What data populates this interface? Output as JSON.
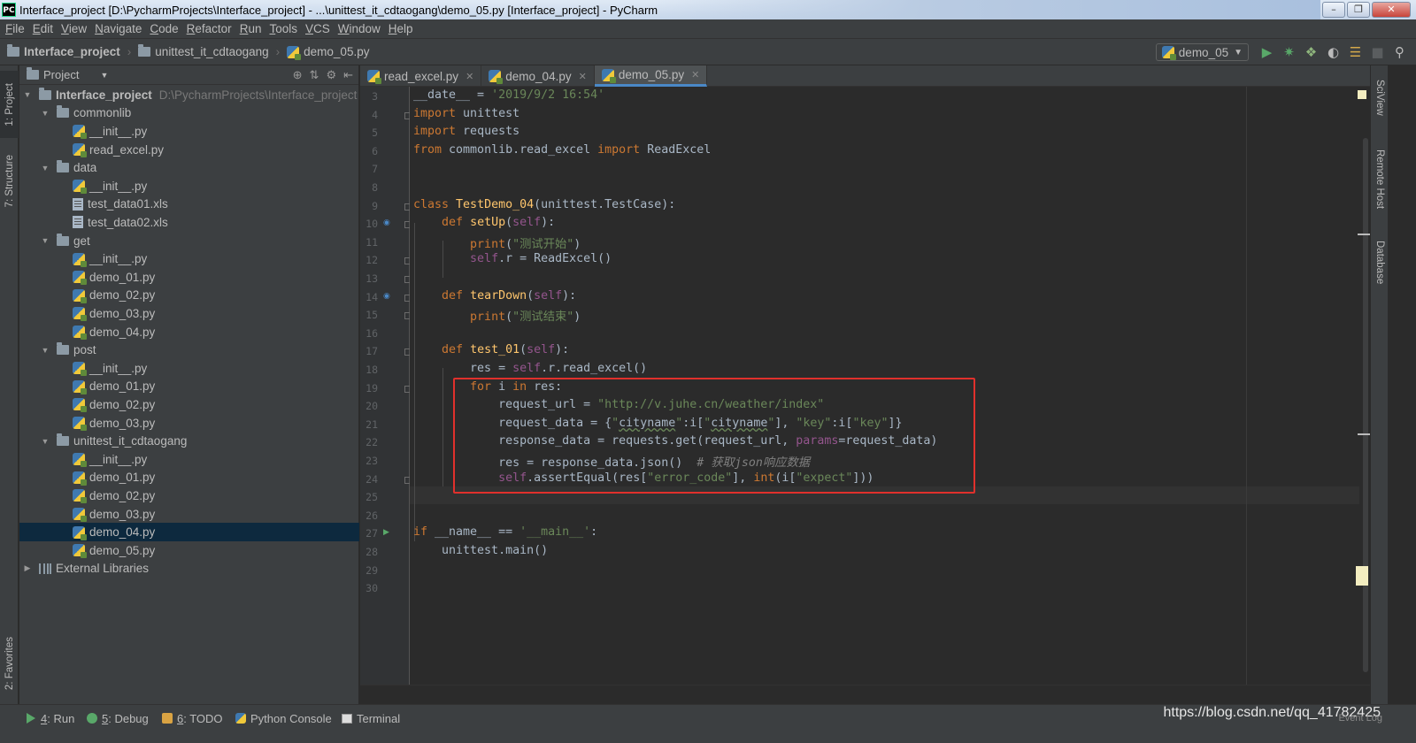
{
  "window": {
    "title": "Interface_project [D:\\PycharmProjects\\Interface_project] - ...\\unittest_it_cdtaogang\\demo_05.py [Interface_project] - PyCharm",
    "app_icon": "PC"
  },
  "menu": [
    {
      "u": "F",
      "rest": "ile"
    },
    {
      "u": "E",
      "rest": "dit"
    },
    {
      "u": "V",
      "rest": "iew"
    },
    {
      "u": "N",
      "rest": "avigate"
    },
    {
      "u": "C",
      "rest": "ode"
    },
    {
      "u": "R",
      "rest": "efactor"
    },
    {
      "u": "R",
      "rest": "un"
    },
    {
      "u": "T",
      "rest": "ools"
    },
    {
      "u": "V",
      "rest": "CS"
    },
    {
      "u": "W",
      "rest": "indow"
    },
    {
      "u": "H",
      "rest": "elp"
    }
  ],
  "breadcrumb": {
    "project": "Interface_project",
    "folder": "unittest_it_cdtaogang",
    "file": "demo_05.py"
  },
  "run_config": {
    "name": "demo_05"
  },
  "left_tabs": {
    "project": "1: Project",
    "structure": "7: Structure",
    "favorites": "2: Favorites"
  },
  "right_tabs": {
    "sciview": "SciView",
    "remote": "Remote Host",
    "database": "Database"
  },
  "project_panel": {
    "header": "Project",
    "root_name": "Interface_project",
    "root_path": "D:\\PycharmProjects\\Interface_project",
    "external": "External Libraries",
    "items": [
      {
        "label": "commonlib",
        "type": "folder",
        "depth": 1
      },
      {
        "label": "__init__.py",
        "type": "py",
        "depth": 2
      },
      {
        "label": "read_excel.py",
        "type": "py",
        "depth": 2
      },
      {
        "label": "data",
        "type": "folder",
        "depth": 1
      },
      {
        "label": "__init__.py",
        "type": "py",
        "depth": 2
      },
      {
        "label": "test_data01.xls",
        "type": "xls",
        "depth": 2
      },
      {
        "label": "test_data02.xls",
        "type": "xls",
        "depth": 2
      },
      {
        "label": "get",
        "type": "folder",
        "depth": 1
      },
      {
        "label": "__init__.py",
        "type": "py",
        "depth": 2
      },
      {
        "label": "demo_01.py",
        "type": "py",
        "depth": 2
      },
      {
        "label": "demo_02.py",
        "type": "py",
        "depth": 2
      },
      {
        "label": "demo_03.py",
        "type": "py",
        "depth": 2
      },
      {
        "label": "demo_04.py",
        "type": "py",
        "depth": 2
      },
      {
        "label": "post",
        "type": "folder",
        "depth": 1
      },
      {
        "label": "__init__.py",
        "type": "py",
        "depth": 2
      },
      {
        "label": "demo_01.py",
        "type": "py",
        "depth": 2
      },
      {
        "label": "demo_02.py",
        "type": "py",
        "depth": 2
      },
      {
        "label": "demo_03.py",
        "type": "py",
        "depth": 2
      },
      {
        "label": "unittest_it_cdtaogang",
        "type": "folder",
        "depth": 1
      },
      {
        "label": "__init__.py",
        "type": "py",
        "depth": 2
      },
      {
        "label": "demo_01.py",
        "type": "py",
        "depth": 2
      },
      {
        "label": "demo_02.py",
        "type": "py",
        "depth": 2
      },
      {
        "label": "demo_03.py",
        "type": "py",
        "depth": 2
      },
      {
        "label": "demo_04.py",
        "type": "py",
        "depth": 2,
        "selected": true
      },
      {
        "label": "demo_05.py",
        "type": "py",
        "depth": 2
      }
    ]
  },
  "editor_tabs": [
    {
      "label": "read_excel.py",
      "active": false
    },
    {
      "label": "demo_04.py",
      "active": false
    },
    {
      "label": "demo_05.py",
      "active": true
    }
  ],
  "code_lines": [
    {
      "n": "3",
      "t": [
        [
          "",
          "__date__ = "
        ],
        [
          "str",
          "'2019/9/2 16:54'"
        ]
      ]
    },
    {
      "n": "4",
      "t": [
        [
          "kw",
          "import"
        ],
        [
          "",
          " unittest"
        ]
      ]
    },
    {
      "n": "5",
      "t": [
        [
          "kw",
          "import"
        ],
        [
          "",
          " requests"
        ]
      ]
    },
    {
      "n": "6",
      "t": [
        [
          "kw",
          "from"
        ],
        [
          "",
          " commonlib.read_excel "
        ],
        [
          "kw",
          "import"
        ],
        [
          "",
          " ReadExcel"
        ]
      ]
    },
    {
      "n": "7",
      "t": []
    },
    {
      "n": "8",
      "t": []
    },
    {
      "n": "9",
      "t": [
        [
          "kw",
          "class"
        ],
        [
          "",
          " "
        ],
        [
          "cls",
          "TestDemo_04"
        ],
        [
          "",
          "(unittest.TestCase):"
        ]
      ]
    },
    {
      "n": "10",
      "t": [
        [
          "",
          "    "
        ],
        [
          "kw",
          "def"
        ],
        [
          "",
          " "
        ],
        [
          "cls",
          "setUp"
        ],
        [
          "",
          "("
        ],
        [
          "self",
          "self"
        ],
        [
          "",
          "):"
        ]
      ]
    },
    {
      "n": "11",
      "t": [
        [
          "",
          "        "
        ],
        [
          "kw",
          "print"
        ],
        [
          "",
          "("
        ],
        [
          "str",
          "\"测试开始\""
        ],
        [
          "",
          ")"
        ]
      ]
    },
    {
      "n": "12",
      "t": [
        [
          "",
          "        "
        ],
        [
          "self",
          "self"
        ],
        [
          "",
          ".r = ReadExcel()"
        ]
      ]
    },
    {
      "n": "13",
      "t": []
    },
    {
      "n": "14",
      "t": [
        [
          "",
          "    "
        ],
        [
          "kw",
          "def"
        ],
        [
          "",
          " "
        ],
        [
          "cls",
          "tearDown"
        ],
        [
          "",
          "("
        ],
        [
          "self",
          "self"
        ],
        [
          "",
          "):"
        ]
      ]
    },
    {
      "n": "15",
      "t": [
        [
          "",
          "        "
        ],
        [
          "kw",
          "print"
        ],
        [
          "",
          "("
        ],
        [
          "str",
          "\"测试结束\""
        ],
        [
          "",
          ")"
        ]
      ]
    },
    {
      "n": "16",
      "t": []
    },
    {
      "n": "17",
      "t": [
        [
          "",
          "    "
        ],
        [
          "kw",
          "def"
        ],
        [
          "",
          " "
        ],
        [
          "cls",
          "test_01"
        ],
        [
          "",
          "("
        ],
        [
          "self",
          "self"
        ],
        [
          "",
          "):"
        ]
      ]
    },
    {
      "n": "18",
      "t": [
        [
          "",
          "        res = "
        ],
        [
          "self",
          "self"
        ],
        [
          "",
          ".r.read_excel()"
        ]
      ]
    },
    {
      "n": "19",
      "t": [
        [
          "",
          "        "
        ],
        [
          "kw",
          "for"
        ],
        [
          "",
          " i "
        ],
        [
          "kw",
          "in"
        ],
        [
          "",
          " res:"
        ]
      ]
    },
    {
      "n": "20",
      "t": [
        [
          "",
          "            request_url = "
        ],
        [
          "str",
          "\"http://v.juhe.cn/weather/index\""
        ]
      ]
    },
    {
      "n": "21",
      "t": [
        [
          "",
          "            request_data = {"
        ],
        [
          "str",
          "\""
        ],
        [
          "sq",
          "cityname"
        ],
        [
          "str",
          "\""
        ],
        [
          "",
          ":i["
        ],
        [
          "str",
          "\""
        ],
        [
          "sq",
          "cityname"
        ],
        [
          "str",
          "\""
        ],
        [
          "",
          "], "
        ],
        [
          "str",
          "\"key\""
        ],
        [
          "",
          ":i["
        ],
        [
          "str",
          "\"key\""
        ],
        [
          "",
          "]}"
        ]
      ]
    },
    {
      "n": "22",
      "t": [
        [
          "",
          "            response_data = requests.get(request_url, "
        ],
        [
          "self",
          "params"
        ],
        [
          "",
          "=request_data)"
        ]
      ]
    },
    {
      "n": "23",
      "t": [
        [
          "",
          "            res = response_data.json()  "
        ],
        [
          "cm",
          "# 获取json响应数据"
        ]
      ]
    },
    {
      "n": "24",
      "t": [
        [
          "",
          "            "
        ],
        [
          "self",
          "self"
        ],
        [
          "",
          ".assertEqual(res["
        ],
        [
          "str",
          "\"error_code\""
        ],
        [
          "",
          "], "
        ],
        [
          "kw",
          "int"
        ],
        [
          "",
          "(i["
        ],
        [
          "str",
          "\"expect\""
        ],
        [
          "",
          "]))"
        ]
      ]
    },
    {
      "n": "25",
      "t": []
    },
    {
      "n": "26",
      "t": []
    },
    {
      "n": "27",
      "t": [
        [
          "kw",
          "if"
        ],
        [
          "",
          " __name__ == "
        ],
        [
          "str",
          "'__main__'"
        ],
        [
          "",
          ":"
        ]
      ]
    },
    {
      "n": "28",
      "t": [
        [
          "",
          "    unittest.main()"
        ]
      ]
    },
    {
      "n": "29",
      "t": []
    },
    {
      "n": "30",
      "t": []
    }
  ],
  "bottom_tools": [
    {
      "u": "4",
      "rest": ": Run",
      "icon": "run-icon"
    },
    {
      "u": "5",
      "rest": ": Debug",
      "icon": "debug-icon"
    },
    {
      "u": "6",
      "rest": ": TODO",
      "icon": "todo-icon"
    },
    {
      "u": "",
      "rest": "Python Console",
      "icon": "python-console-icon"
    },
    {
      "u": "",
      "rest": "Terminal",
      "icon": "terminal-icon"
    }
  ],
  "status": {
    "watermark": "https://blog.csdn.net/qq_41782425",
    "event_log": "Event Log"
  },
  "colors": {
    "keyword": "#cc7832",
    "string": "#6a8759",
    "function": "#ffc66d",
    "self": "#94558d",
    "highlight_box": "#e0302c",
    "selection": "#0d293e"
  }
}
